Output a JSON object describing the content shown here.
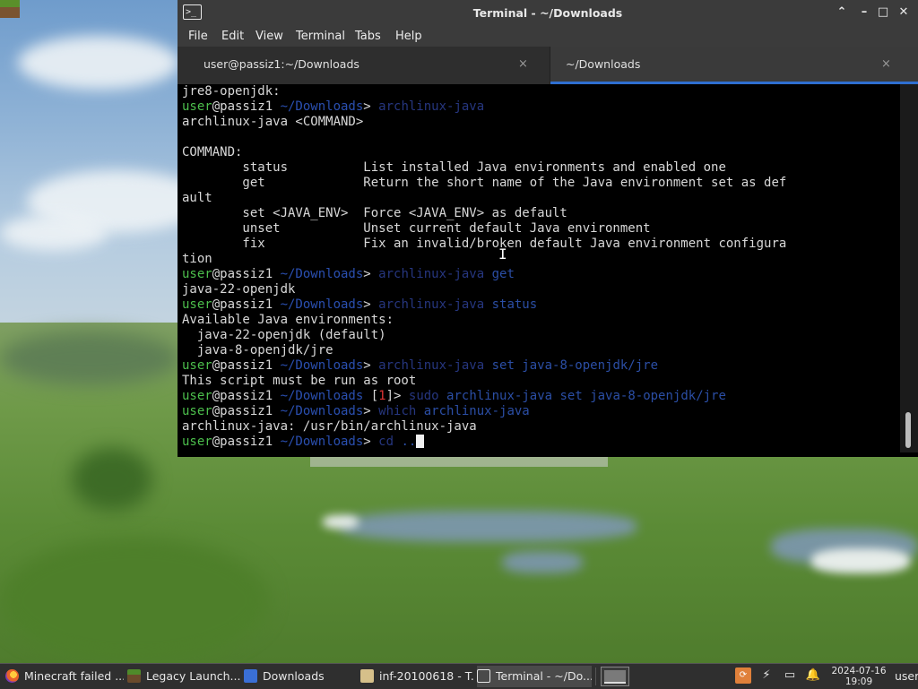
{
  "window": {
    "title": "Terminal - ~/Downloads",
    "controls": {
      "up": "⌃",
      "minimize": "–",
      "maximize": "□",
      "close": "✕"
    },
    "menu": [
      "File",
      "Edit",
      "View",
      "Terminal",
      "Tabs",
      "Help"
    ],
    "tabs": [
      {
        "label": "user@passiz1:~/Downloads",
        "close": "×",
        "active": false
      },
      {
        "label": "~/Downloads",
        "close": "×",
        "active": true
      }
    ]
  },
  "terminal": {
    "lines": [
      [
        {
          "t": "jre8-openjdk:"
        }
      ],
      [
        {
          "t": "user",
          "c": "u-g"
        },
        {
          "t": "@passiz1 "
        },
        {
          "t": "~/Downloads",
          "c": "u-path"
        },
        {
          "t": "> "
        },
        {
          "t": "archlinux-java",
          "c": "u-cmd"
        }
      ],
      [
        {
          "t": "archlinux-java <COMMAND>"
        }
      ],
      [
        {
          "t": ""
        }
      ],
      [
        {
          "t": "COMMAND:"
        }
      ],
      [
        {
          "t": "        status          List installed Java environments and enabled one"
        }
      ],
      [
        {
          "t": "        get             Return the short name of the Java environment set as def"
        }
      ],
      [
        {
          "t": "ault"
        }
      ],
      [
        {
          "t": "        set <JAVA_ENV>  Force <JAVA_ENV> as default"
        }
      ],
      [
        {
          "t": "        unset           Unset current default Java environment"
        }
      ],
      [
        {
          "t": "        fix             Fix an invalid/broken default Java environment configura"
        }
      ],
      [
        {
          "t": "tion"
        }
      ],
      [
        {
          "t": "user",
          "c": "u-g"
        },
        {
          "t": "@passiz1 "
        },
        {
          "t": "~/Downloads",
          "c": "u-path"
        },
        {
          "t": "> "
        },
        {
          "t": "archlinux-java ",
          "c": "u-cmd"
        },
        {
          "t": "get",
          "c": "u-cmd2"
        }
      ],
      [
        {
          "t": "java-22-openjdk"
        }
      ],
      [
        {
          "t": "user",
          "c": "u-g"
        },
        {
          "t": "@passiz1 "
        },
        {
          "t": "~/Downloads",
          "c": "u-path"
        },
        {
          "t": "> "
        },
        {
          "t": "archlinux-java ",
          "c": "u-cmd"
        },
        {
          "t": "status",
          "c": "u-cmd2"
        }
      ],
      [
        {
          "t": "Available Java environments:"
        }
      ],
      [
        {
          "t": "  java-22-openjdk (default)"
        }
      ],
      [
        {
          "t": "  java-8-openjdk/jre"
        }
      ],
      [
        {
          "t": "user",
          "c": "u-g"
        },
        {
          "t": "@passiz1 "
        },
        {
          "t": "~/Downloads",
          "c": "u-path"
        },
        {
          "t": "> "
        },
        {
          "t": "archlinux-java ",
          "c": "u-cmd"
        },
        {
          "t": "set java-8-openjdk/jre",
          "c": "u-cmd2"
        }
      ],
      [
        {
          "t": "This script must be run as root"
        }
      ],
      [
        {
          "t": "user",
          "c": "u-g"
        },
        {
          "t": "@passiz1 "
        },
        {
          "t": "~/Downloads",
          "c": "u-path"
        },
        {
          "t": " ["
        },
        {
          "t": "1",
          "c": "u-err"
        },
        {
          "t": "]> "
        },
        {
          "t": "sudo ",
          "c": "u-cmd"
        },
        {
          "t": "archlinux-java set java-8-openjdk/jre",
          "c": "u-cmd2"
        }
      ],
      [
        {
          "t": "user",
          "c": "u-g"
        },
        {
          "t": "@passiz1 "
        },
        {
          "t": "~/Downloads",
          "c": "u-path"
        },
        {
          "t": "> "
        },
        {
          "t": "which ",
          "c": "u-cmd"
        },
        {
          "t": "archlinux-java",
          "c": "u-cmd2"
        }
      ],
      [
        {
          "t": "archlinux-java: /usr/bin/archlinux-java"
        }
      ],
      [
        {
          "t": "user",
          "c": "u-g"
        },
        {
          "t": "@passiz1 "
        },
        {
          "t": "~/Downloads",
          "c": "u-path"
        },
        {
          "t": "> "
        },
        {
          "t": "cd ",
          "c": "u-cmd"
        },
        {
          "t": "..",
          "c": "u-cmd2"
        }
      ]
    ]
  },
  "taskbar": {
    "tasks": [
      {
        "label": "Minecraft failed ...",
        "icon": "firefox-icon",
        "active": false
      },
      {
        "label": "Legacy Launch...",
        "icon": "minecraft-icon",
        "active": false
      },
      {
        "label": "Downloads",
        "icon": "file-manager-icon",
        "active": false
      },
      {
        "label": "inf-20100618 - T...",
        "icon": "folder-icon",
        "active": false
      },
      {
        "label": "Terminal - ~/Do...",
        "icon": "terminal-icon",
        "active": true
      }
    ],
    "clock_date": "2024-07-16",
    "clock_time": "19:09",
    "user": "user"
  }
}
